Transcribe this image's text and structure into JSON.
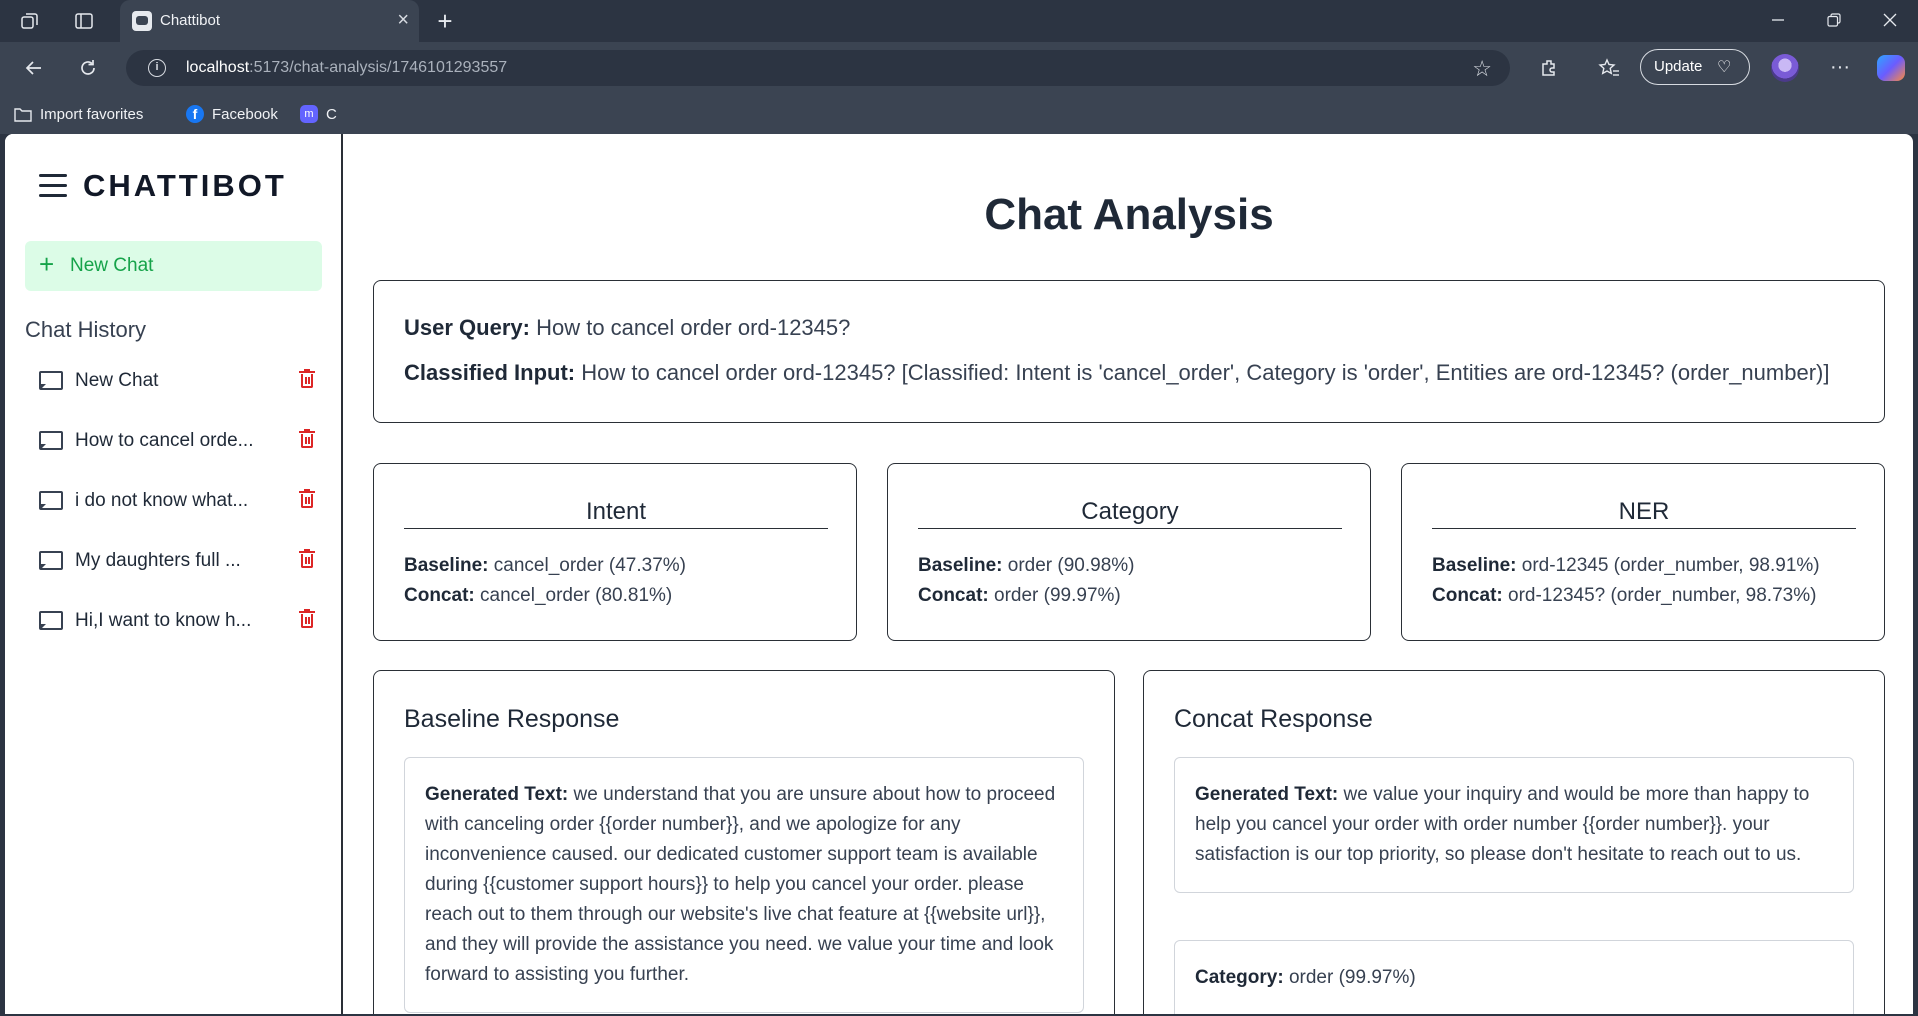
{
  "browser": {
    "tab_title": "Chattibot",
    "url_host": "localhost",
    "url_path": ":5173/chat-analysis/1746101293557",
    "update_label": "Update",
    "bookmarks": [
      "Import favorites",
      "Facebook",
      "C"
    ]
  },
  "sidebar": {
    "brand": "CHATTIBOT",
    "new_chat_label": "New Chat",
    "history_title": "Chat History",
    "items": [
      {
        "label": "New Chat"
      },
      {
        "label": "How to cancel orde..."
      },
      {
        "label": "i do not know what..."
      },
      {
        "label": "My daughters full ..."
      },
      {
        "label": "Hi,I want to know h..."
      }
    ]
  },
  "main": {
    "title": "Chat Analysis",
    "query": {
      "user_query_label": "User Query:",
      "user_query": "How to cancel order ord-12345?",
      "classified_label": "Classified Input:",
      "classified": "How to cancel order ord-12345? [Classified: Intent is 'cancel_order', Category is 'order', Entities are ord-12345? (order_number)]"
    },
    "metrics": [
      {
        "title": "Intent",
        "baseline_label": "Baseline:",
        "baseline": "cancel_order (47.37%)",
        "concat_label": "Concat:",
        "concat": "cancel_order (80.81%)"
      },
      {
        "title": "Category",
        "baseline_label": "Baseline:",
        "baseline": "order (90.98%)",
        "concat_label": "Concat:",
        "concat": "order (99.97%)"
      },
      {
        "title": "NER",
        "baseline_label": "Baseline:",
        "baseline": "ord-12345 (order_number, 98.91%)",
        "concat_label": "Concat:",
        "concat": "ord-12345? (order_number, 98.73%)"
      }
    ],
    "baseline_response": {
      "title": "Baseline Response",
      "generated_label": "Generated Text:",
      "generated": "we understand that you are unsure about how to proceed with canceling order {{order number}}, and we apologize for any inconvenience caused. our dedicated customer support team is available during {{customer support hours}} to help you cancel your order. please reach out to them through our website's live chat feature at {{website url}}, and they will provide the assistance you need. we value your time and look forward to assisting you further."
    },
    "concat_response": {
      "title": "Concat Response",
      "generated_label": "Generated Text:",
      "generated": "we value your inquiry and would be more than happy to help you cancel your order with order number {{order number}}. your satisfaction is our top priority, so please don't hesitate to reach out to us.",
      "category_label": "Category:",
      "category": "order (99.97%)"
    }
  }
}
